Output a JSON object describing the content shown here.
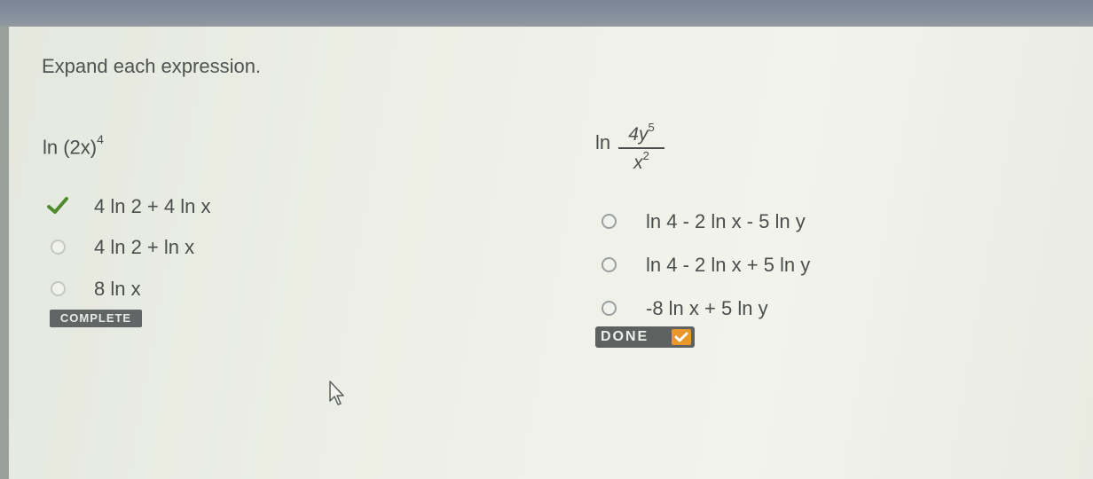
{
  "instruction": "Expand each expression.",
  "question1": {
    "expression_base": "ln (2x)",
    "expression_exponent": "4",
    "options": [
      {
        "label": "4 ln 2 + 4 ln x",
        "state": "correct-selected"
      },
      {
        "label": "4 ln 2 + ln x",
        "state": "unselected"
      },
      {
        "label": "8 ln x",
        "state": "unselected"
      }
    ],
    "status_badge": "COMPLETE"
  },
  "question2": {
    "ln_label": "ln",
    "numerator_base": "4y",
    "numerator_exponent": "5",
    "denominator_base": "x",
    "denominator_exponent": "2",
    "options": [
      {
        "label": "ln 4 - 2 ln x - 5 ln y",
        "state": "unselected"
      },
      {
        "label": "ln 4 - 2 ln x + 5 ln y",
        "state": "unselected"
      },
      {
        "label": "-8 ln x + 5 ln y",
        "state": "unselected"
      }
    ],
    "done_button": "DONE"
  },
  "colors": {
    "check_green": "#4f8a2e",
    "done_accent": "#e9962a"
  },
  "icons": [
    "checkmark-icon",
    "radio-icon",
    "done-check-icon",
    "mouse-cursor-icon"
  ]
}
